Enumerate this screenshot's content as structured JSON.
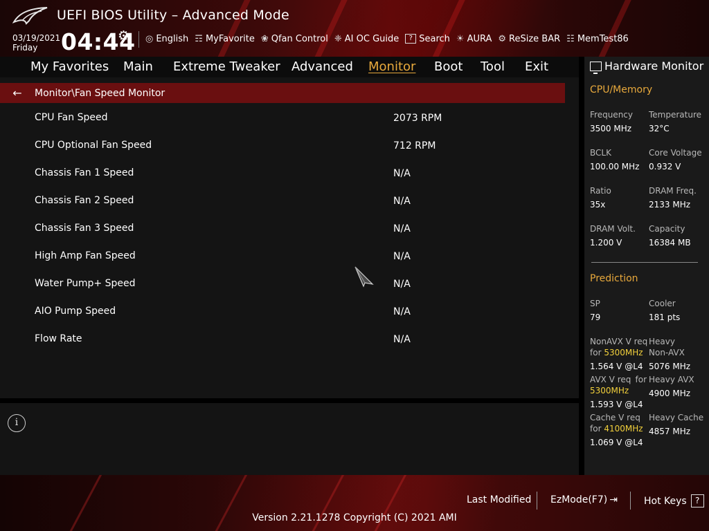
{
  "header": {
    "title": "UEFI BIOS Utility – Advanced Mode",
    "date": "03/19/2021",
    "day": "Friday",
    "time": "04:44",
    "toolbar": [
      {
        "icon": "globe-icon",
        "glyph": "◎",
        "label": "English"
      },
      {
        "icon": "favorite-icon",
        "glyph": "☶",
        "label": "MyFavorite"
      },
      {
        "icon": "fan-icon",
        "glyph": "❀",
        "label": "Qfan Control"
      },
      {
        "icon": "chip-icon",
        "glyph": "❈",
        "label": "AI OC Guide"
      },
      {
        "icon": "search-icon",
        "glyph": "?",
        "label": "Search"
      },
      {
        "icon": "aura-icon",
        "glyph": "☀",
        "label": "AURA"
      },
      {
        "icon": "resize-bar-icon",
        "glyph": "⚙",
        "label": "ReSize BAR"
      },
      {
        "icon": "memtest-icon",
        "glyph": "☷",
        "label": "MemTest86"
      }
    ]
  },
  "menu": {
    "items": [
      "My Favorites",
      "Main",
      "Extreme Tweaker",
      "Advanced",
      "Monitor",
      "Boot",
      "Tool",
      "Exit"
    ],
    "active": "Monitor"
  },
  "breadcrumb": "Monitor\\Fan Speed Monitor",
  "rows": [
    {
      "label": "CPU Fan Speed",
      "value": "2073 RPM"
    },
    {
      "label": "CPU Optional Fan Speed",
      "value": "712 RPM"
    },
    {
      "label": "Chassis Fan 1 Speed",
      "value": "N/A"
    },
    {
      "label": "Chassis Fan 2 Speed",
      "value": "N/A"
    },
    {
      "label": "Chassis Fan 3 Speed",
      "value": "N/A"
    },
    {
      "label": "High Amp Fan Speed",
      "value": "N/A"
    },
    {
      "label": "Water Pump+ Speed",
      "value": "N/A"
    },
    {
      "label": "AIO Pump Speed",
      "value": "N/A"
    },
    {
      "label": "Flow Rate",
      "value": "N/A"
    }
  ],
  "hardware_monitor": {
    "title": "Hardware Monitor",
    "cpu_memory": {
      "title": "CPU/Memory",
      "frequency_label": "Frequency",
      "frequency": "3500 MHz",
      "temperature_label": "Temperature",
      "temperature": "32°C",
      "bclk_label": "BCLK",
      "bclk": "100.00 MHz",
      "core_voltage_label": "Core Voltage",
      "core_voltage": "0.932 V",
      "ratio_label": "Ratio",
      "ratio": "35x",
      "dram_freq_label": "DRAM Freq.",
      "dram_freq": "2133 MHz",
      "dram_volt_label": "DRAM Volt.",
      "dram_volt": "1.200 V",
      "capacity_label": "Capacity",
      "capacity": "16384 MB"
    },
    "prediction": {
      "title": "Prediction",
      "sp_label": "SP",
      "sp": "79",
      "cooler_label": "Cooler",
      "cooler": "181 pts",
      "nonavx_label_a": "NonAVX V req",
      "nonavx_label_b": "for",
      "nonavx_freq": "5300MHz",
      "nonavx_v": "1.564 V @L4",
      "heavy_nonavx_label_a": "Heavy",
      "heavy_nonavx_label_b": "Non-AVX",
      "heavy_nonavx": "5076 MHz",
      "avx_label_a": "AVX V req",
      "avx_label_b": "for",
      "avx_freq": "5300MHz",
      "avx_v": "1.593 V @L4",
      "heavy_avx_label": "Heavy AVX",
      "heavy_avx": "4900 MHz",
      "cache_label_a": "Cache V req",
      "cache_label_b": "for",
      "cache_freq": "4100MHz",
      "cache_v": "1.069 V @L4",
      "heavy_cache_label": "Heavy Cache",
      "heavy_cache": "4857 MHz"
    }
  },
  "footer": {
    "last_modified": "Last Modified",
    "ezmode": "EzMode(F7)",
    "ezmode_glyph": "⇥",
    "hot_keys": "Hot Keys",
    "hot_keys_glyph": "?",
    "version": "Version 2.21.1278 Copyright (C) 2021 AMI"
  }
}
